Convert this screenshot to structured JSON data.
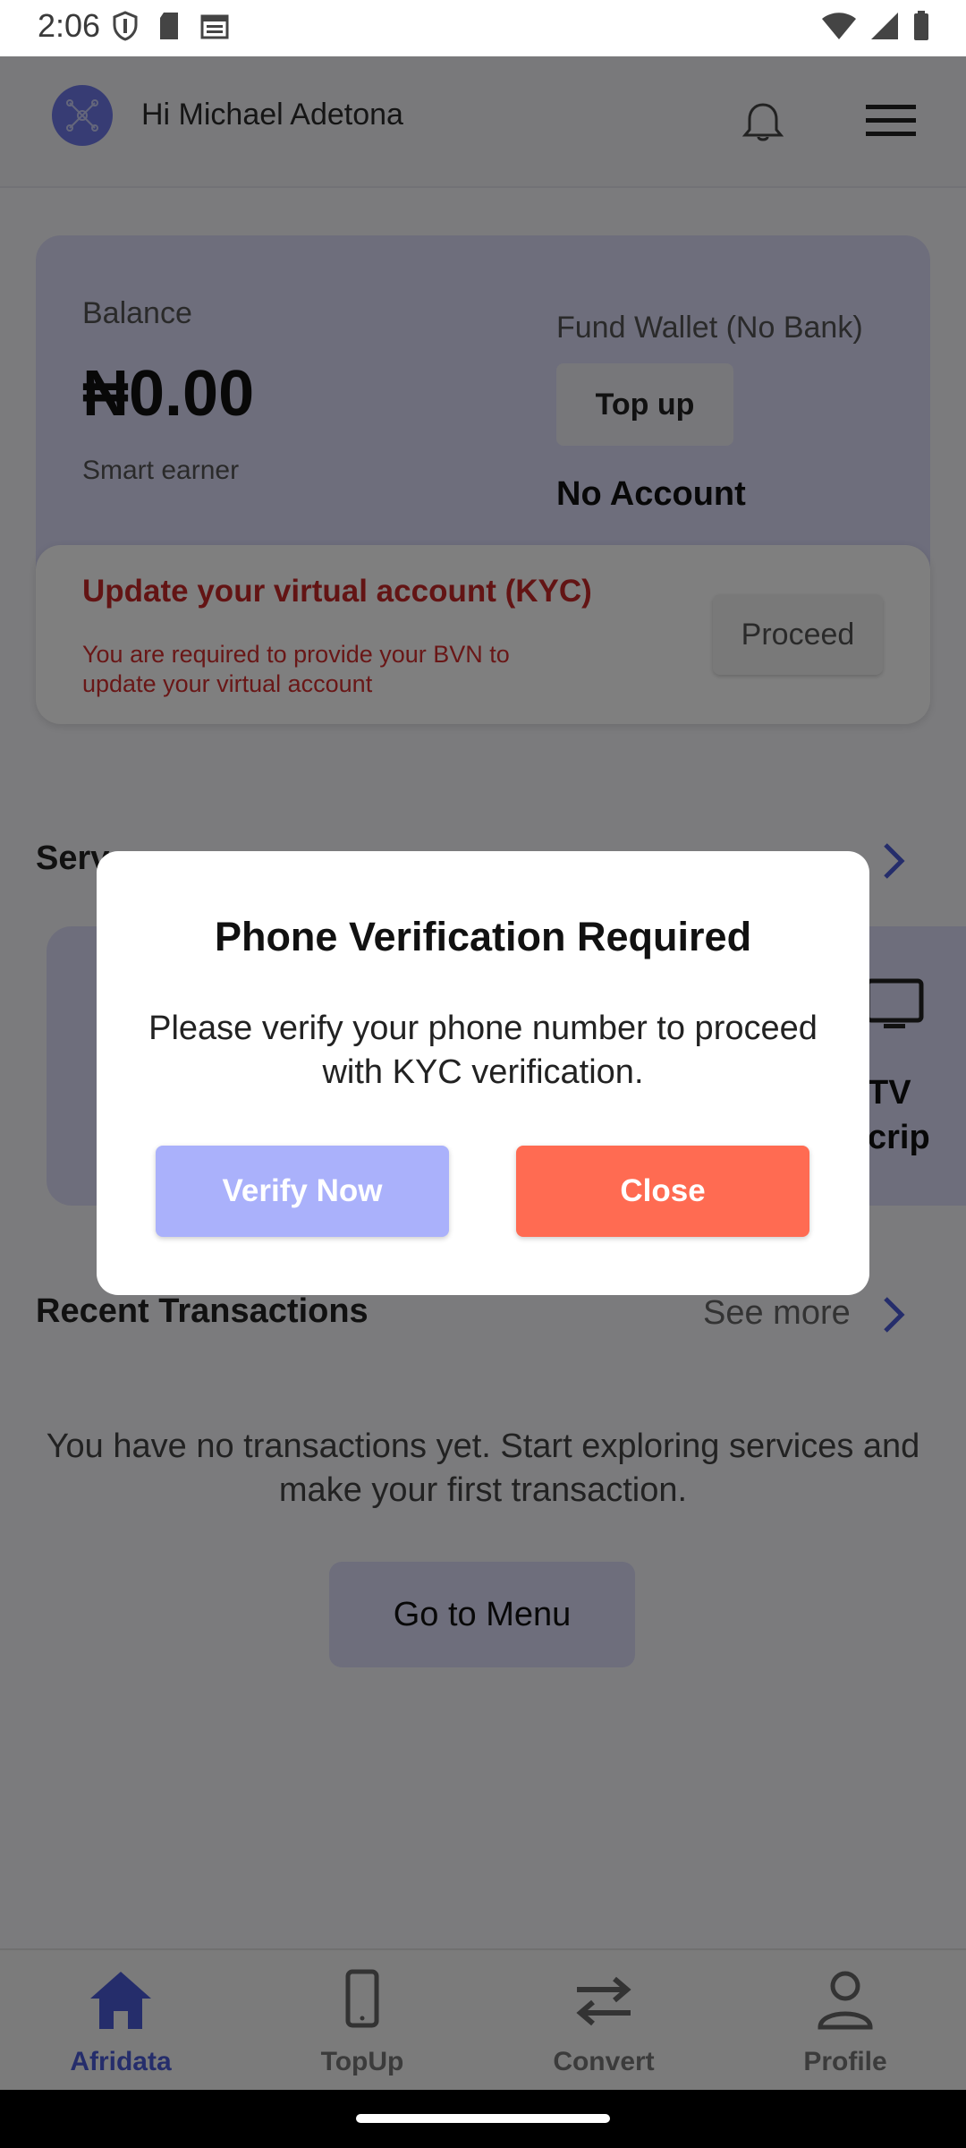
{
  "status_bar": {
    "time": "2:06"
  },
  "header": {
    "greeting": "Hi Michael Adetona"
  },
  "balance_card": {
    "label": "Balance",
    "amount": "₦0.00",
    "subtitle": "Smart earner",
    "fund_label": "Fund Wallet (No Bank)",
    "topup_label": "Top up",
    "account_status": "No Account"
  },
  "kyc_card": {
    "title": "Update your virtual account (KYC)",
    "message": "You are required to provide your BVN to update your virtual account",
    "proceed_label": "Proceed"
  },
  "services": {
    "title_visible": "Serv",
    "tv_label_line1": "TV",
    "tv_label_line2": "crip"
  },
  "transactions": {
    "title": "Recent Transactions",
    "see_more": "See more",
    "empty_message": "You have no transactions yet. Start exploring services and make your first transaction.",
    "menu_button": "Go to Menu"
  },
  "bottom_nav": {
    "items": [
      {
        "label": "Afridata",
        "icon": "home-icon",
        "active": true
      },
      {
        "label": "TopUp",
        "icon": "phone-icon",
        "active": false
      },
      {
        "label": "Convert",
        "icon": "swap-icon",
        "active": false
      },
      {
        "label": "Profile",
        "icon": "person-icon",
        "active": false
      }
    ]
  },
  "dialog": {
    "title": "Phone Verification Required",
    "message": "Please verify your phone number to proceed with KYC verification.",
    "verify_label": "Verify Now",
    "close_label": "Close"
  },
  "colors": {
    "accent": "#4a5bd6",
    "danger": "#c62828",
    "verify_button": "#aab1fb",
    "close_button": "#ff6b52",
    "card": "#dcdcf9"
  }
}
